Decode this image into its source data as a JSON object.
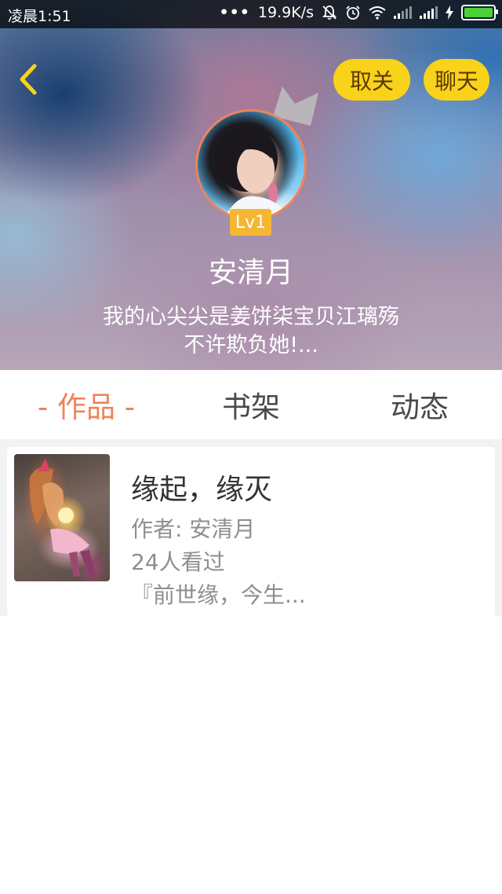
{
  "status_bar": {
    "time": "凌晨1:51",
    "dots": "•••",
    "net_speed": "19.9K/s",
    "battery_color": "#4cd137"
  },
  "header": {
    "back_icon": "chevron-left-icon",
    "unfollow_label": "取关",
    "chat_label": "聊天",
    "level": "Lv1",
    "username": "安清月",
    "bio": "我的心尖尖是姜饼柒宝贝江璃殇\n不许欺负她!...",
    "accent_color": "#f9d21a",
    "back_color": "#f9d21a"
  },
  "tabs": [
    {
      "label": "- 作品 -",
      "active": true
    },
    {
      "label": "书架",
      "active": false
    },
    {
      "label": "动态",
      "active": false
    }
  ],
  "works": [
    {
      "title": "缘起，缘灭",
      "author": "作者: 安清月",
      "views": "24人看过",
      "excerpt": "『前世缘，今生..."
    }
  ],
  "colors": {
    "active_tab": "#f0825a",
    "level_badge": "#f5b633"
  }
}
